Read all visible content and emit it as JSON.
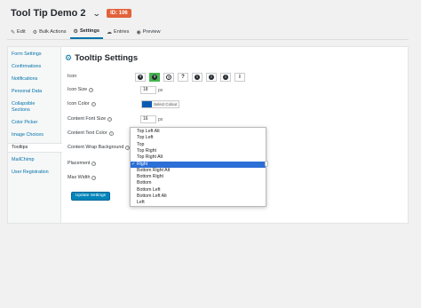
{
  "header": {
    "form_title": "Tool Tip Demo 2",
    "id_badge": "ID: 106"
  },
  "tabs": [
    {
      "icon": "edit-icon",
      "label": "Edit"
    },
    {
      "icon": "bulk-actions-icon",
      "label": "Bulk Actions"
    },
    {
      "icon": "settings-icon",
      "label": "Settings",
      "active": true
    },
    {
      "icon": "entries-icon",
      "label": "Entries"
    },
    {
      "icon": "preview-icon",
      "label": "Preview"
    }
  ],
  "sidebar": {
    "items": [
      {
        "label": "Form Settings"
      },
      {
        "label": "Confirmations"
      },
      {
        "label": "Notifications"
      },
      {
        "label": "Personal Data"
      },
      {
        "label": "Collapsible\nSections"
      },
      {
        "label": "Color Picker"
      },
      {
        "label": "Image Choices"
      },
      {
        "label": "Tooltips",
        "active": true
      },
      {
        "label": "MailChimp"
      },
      {
        "label": "User Registration"
      }
    ]
  },
  "settings": {
    "title": "Tooltip Settings",
    "icon_label": "Icon",
    "icon_size_label": "Icon Size",
    "icon_size_value": "18",
    "icon_size_unit": "px",
    "icon_color_label": "Icon Color",
    "icon_color_button": "Select Colour",
    "icon_color_value": "#0a5cb3",
    "font_size_label": "Content Font Size",
    "font_size_value": "16",
    "font_size_unit": "px",
    "text_color_label": "Content Text Color",
    "wrap_bg_label": "Content Wrap Background",
    "placement_label": "Placement",
    "max_width_label": "Max Width",
    "update_button": "Update Settings"
  },
  "placement_options": [
    "Top Left Alt",
    "Top Left",
    "Top",
    "Top Right",
    "Top Right Alt",
    "Right",
    "Bottom Right Alt",
    "Bottom Right",
    "Bottom",
    "Bottom Left",
    "Bottom Left Alt",
    "Left"
  ],
  "placement_selected": "Right",
  "icon_choices": [
    "question-circle",
    "question-circle-selected",
    "question-outline",
    "question-plain",
    "info-circle",
    "info-circle-2",
    "info-circle-3",
    "info-plain"
  ],
  "colors": {
    "accent": "#0073aa",
    "badge": "#e2623a",
    "selected": "#2c6fd6",
    "icon_selected_bg": "#46b450"
  }
}
